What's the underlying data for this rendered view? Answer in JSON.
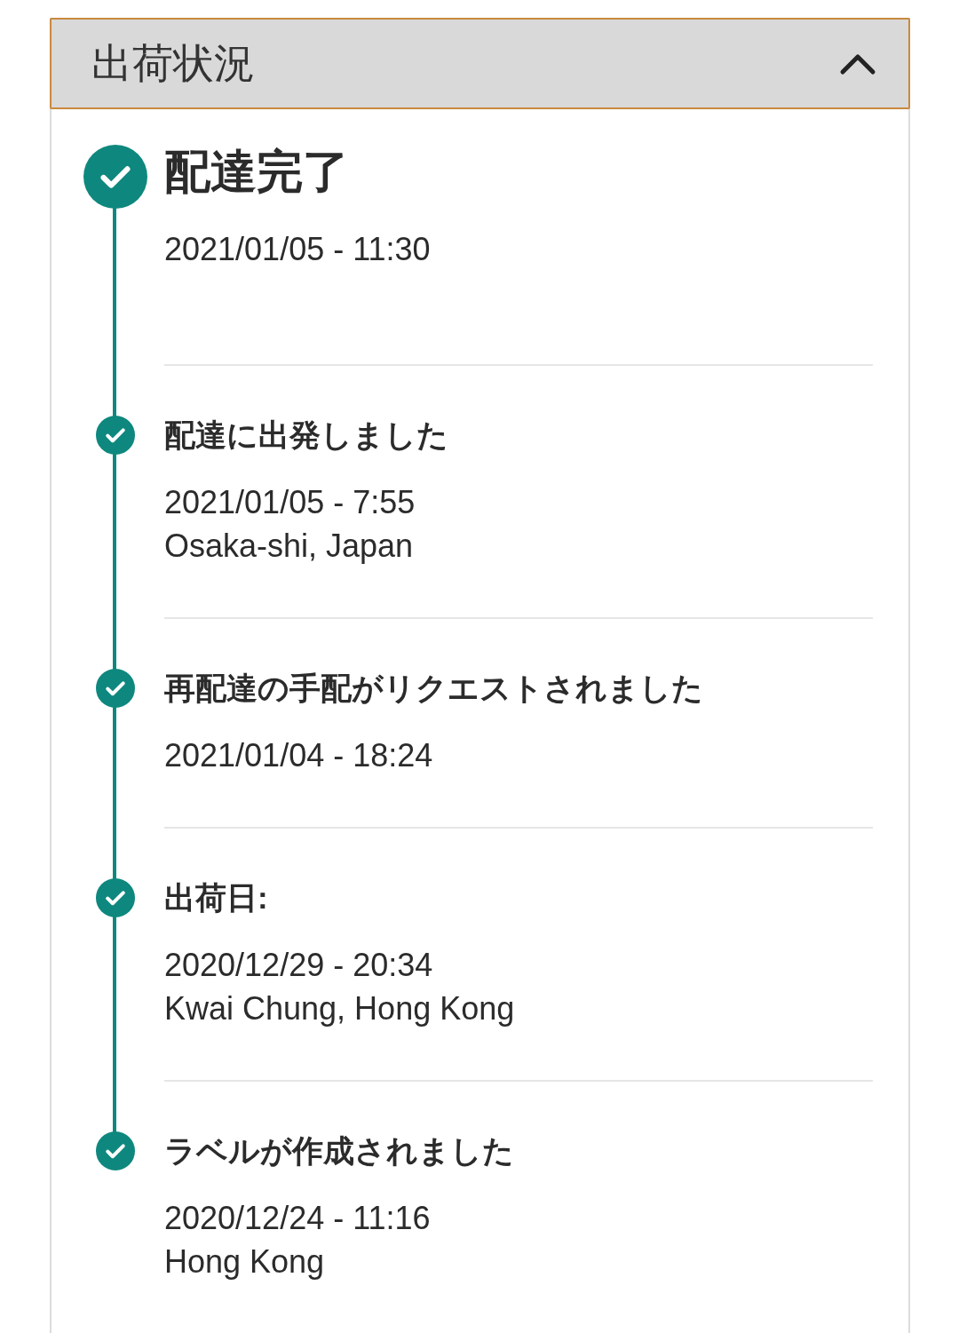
{
  "panel": {
    "title": "出荷状況",
    "expanded": true
  },
  "events": [
    {
      "kind": "current",
      "title": "配達完了",
      "time": "2021/01/05 - 11:30",
      "completed": true
    },
    {
      "kind": "past",
      "title": "配達に出発しました",
      "time": "2021/01/05 - 7:55",
      "location": "Osaka-shi, Japan",
      "completed": true
    },
    {
      "kind": "past",
      "title": "再配達の手配がリクエストされました",
      "time": "2021/01/04 - 18:24",
      "completed": true
    },
    {
      "kind": "past",
      "title": "出荷日:",
      "time": "2020/12/29 - 20:34",
      "location": "Kwai Chung, Hong Kong",
      "completed": true
    },
    {
      "kind": "past",
      "title": "ラベルが作成されました",
      "time": "2020/12/24 - 11:16",
      "location": "Hong Kong",
      "completed": true
    }
  ]
}
